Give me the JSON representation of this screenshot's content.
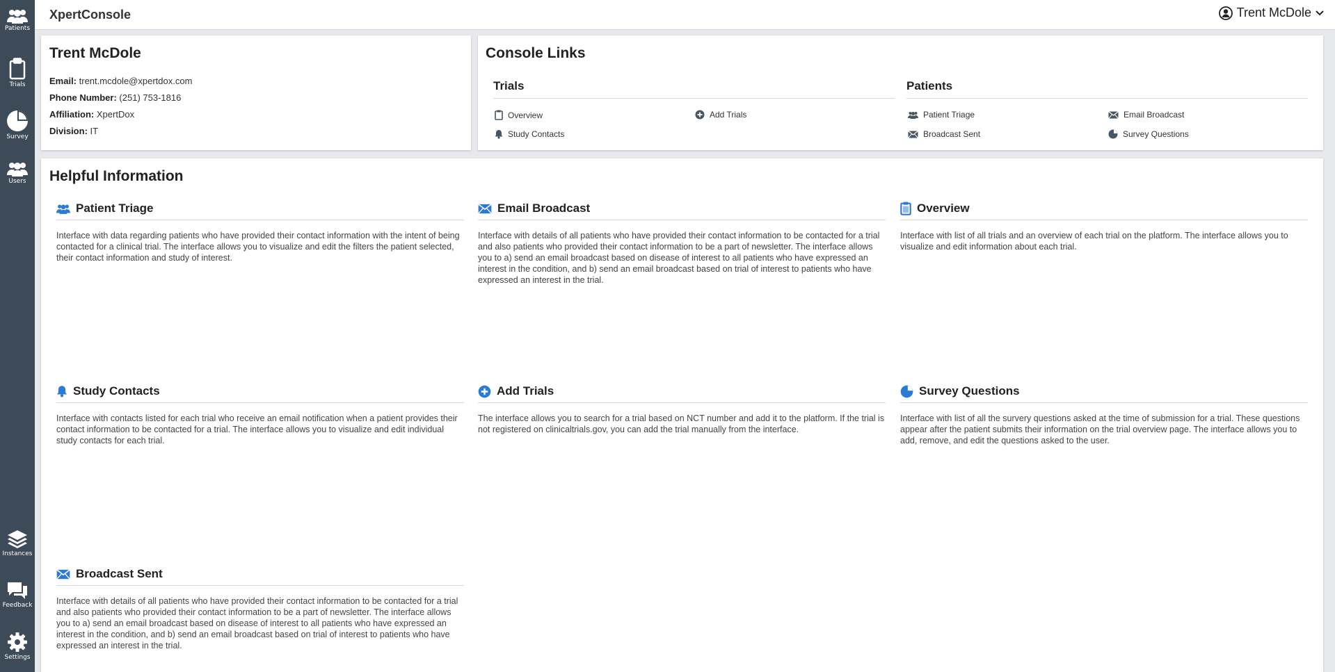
{
  "app": {
    "brand": "XpertConsole",
    "user_name": "Trent McDole"
  },
  "sidebar": {
    "items": [
      {
        "label": "Patients",
        "icon": "users-icon"
      },
      {
        "label": "Trials",
        "icon": "clipboard-icon"
      },
      {
        "label": "Survey",
        "icon": "pie-chart-icon"
      },
      {
        "label": "Users",
        "icon": "users-icon"
      },
      {
        "label": "Instances",
        "icon": "layers-icon"
      },
      {
        "label": "Feedback",
        "icon": "chat-icon"
      },
      {
        "label": "Settings",
        "icon": "gear-icon"
      }
    ]
  },
  "profile": {
    "name": "Trent McDole",
    "email_label": "Email:",
    "email": "trent.mcdole@xpertdox.com",
    "phone_label": "Phone Number:",
    "phone": "(251) 753-1816",
    "affiliation_label": "Affiliation:",
    "affiliation": "XpertDox",
    "division_label": "Division:",
    "division": "IT"
  },
  "console_links": {
    "title": "Console Links",
    "trials": {
      "title": "Trials",
      "links": [
        {
          "label": "Overview",
          "icon": "clipboard-icon"
        },
        {
          "label": "Add Trials",
          "icon": "plus-circle-icon"
        },
        {
          "label": "Study Contacts",
          "icon": "bell-icon"
        }
      ]
    },
    "patients": {
      "title": "Patients",
      "links": [
        {
          "label": "Patient Triage",
          "icon": "users-icon"
        },
        {
          "label": "Email Broadcast",
          "icon": "envelope-icon"
        },
        {
          "label": "Broadcast Sent",
          "icon": "envelope-icon"
        },
        {
          "label": "Survey Questions",
          "icon": "pie-chart-icon"
        }
      ]
    }
  },
  "helpful": {
    "title": "Helpful Information",
    "items": [
      {
        "title": "Patient Triage",
        "icon": "users-icon",
        "text": "Interface with data regarding patients who have provided their contact information with the intent of being contacted for a clinical trial. The interface allows you to visualize and edit the filters the patient selected, their contact information and study of interest."
      },
      {
        "title": "Email Broadcast",
        "icon": "envelope-icon",
        "text": "Interface with details of all patients who have provided their contact information to be contacted for a trial and also patients who provided their contact information to be a part of newsletter. The interface allows you to a) send an email broadcast based on disease of interest to all patients who have expressed an interest in the condition, and b) send an email broadcast based on trial of interest to patients who have expressed an interest in the trial."
      },
      {
        "title": "Overview",
        "icon": "clipboard-icon",
        "text": "Interface with list of all trials and an overview of each trial on the platform. The interface allows you to visualize and edit information about each trial."
      },
      {
        "title": "Study Contacts",
        "icon": "bell-icon",
        "text": "Interface with contacts listed for each trial who receive an email notification when a patient provides their contact information to be contacted for a trial. The interface allows you to visualize and edit individual study contacts for each trial."
      },
      {
        "title": "Add Trials",
        "icon": "plus-circle-icon",
        "text": "The interface allows you to search for a trial based on NCT number and add it to the platform. If the trial is not registered on clinicaltrials.gov, you can add the trial manually from the interface."
      },
      {
        "title": "Survey Questions",
        "icon": "pie-chart-icon",
        "text": "Interface with list of all the survery questions asked at the time of submission for a trial. These questions appear after the patient submits their information on the trial overview page. The interface allows you to add, remove, and edit the questions asked to the user."
      },
      {
        "title": "Broadcast Sent",
        "icon": "envelope-icon",
        "text": "Interface with details of all patients who have provided their contact information to be contacted for a trial and also patients who provided their contact information to be a part of newsletter. The interface allows you to a) send an email broadcast based on disease of interest to all patients who have expressed an interest in the condition, and b) send an email broadcast based on trial of interest to patients who have expressed an interest in the trial."
      }
    ]
  },
  "colors": {
    "sidebar": "#3d4a57",
    "accent": "#2a7bd5",
    "link_icon": "#4a5562"
  }
}
